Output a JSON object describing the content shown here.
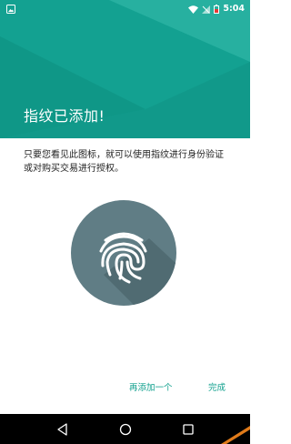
{
  "status_bar": {
    "time": "5:04"
  },
  "header": {
    "title": "指纹已添加!"
  },
  "body": {
    "description": "只要您看见此图标，就可以使用指纹进行身份验证或对购买交易进行授权。"
  },
  "actions": {
    "add_another": "再添加一个",
    "done": "完成"
  },
  "colors": {
    "header": "#13a191",
    "accent": "#0d9f8c",
    "fingerprint_circle": "#607d85"
  },
  "icons": [
    "photo-notification-icon",
    "wifi-icon",
    "signal-icon",
    "battery-icon",
    "fingerprint-icon",
    "back-icon",
    "home-icon",
    "recents-icon"
  ]
}
